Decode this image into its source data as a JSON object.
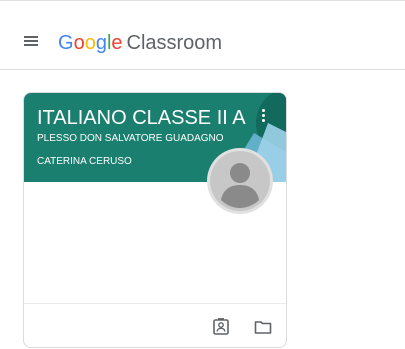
{
  "header": {
    "menu_icon": "hamburger-menu-icon",
    "brand": {
      "letters": [
        "G",
        "o",
        "o",
        "g",
        "l",
        "e"
      ],
      "product": "Classroom"
    }
  },
  "class_card": {
    "title": "ITALIANO CLASSE II A",
    "section": "PLESSO DON SALVATORE GUADAGNO",
    "teacher": "CATERINA CERUSO",
    "more_icon": "more-vertical-icon",
    "avatar_icon": "person-avatar-icon",
    "footer_icons": [
      "portfolio-icon",
      "folder-icon"
    ]
  },
  "colors": {
    "banner": "#1a7f6e",
    "google_blue": "#4285f4",
    "google_red": "#ea4335",
    "google_yellow": "#fbbc05",
    "google_green": "#34a853",
    "product_gray": "#5f6368"
  }
}
